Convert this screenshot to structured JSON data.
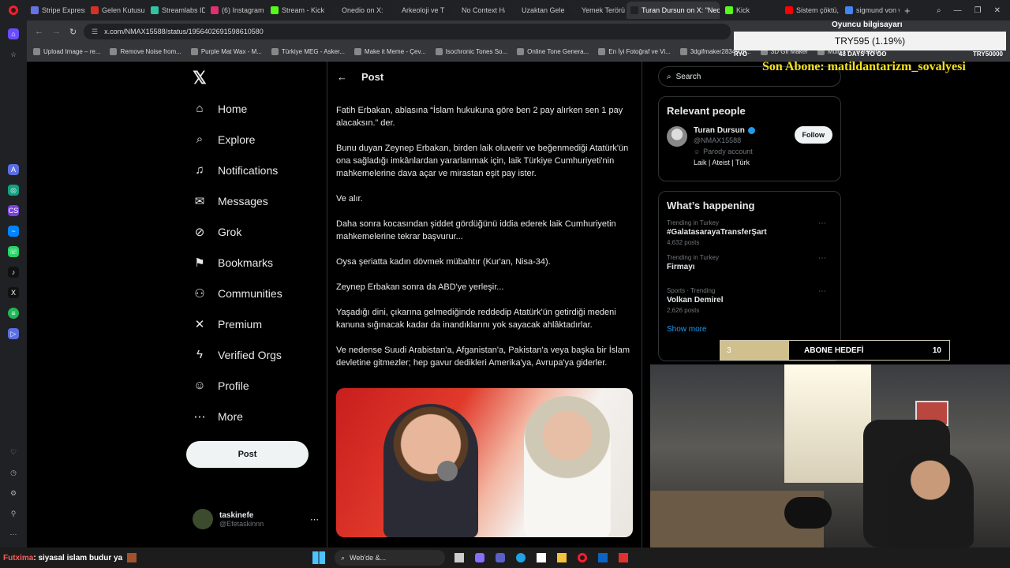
{
  "browser": {
    "tabs": [
      {
        "label": "Stripe Express",
        "color": "#6772e5"
      },
      {
        "label": "Gelen Kutusu (5",
        "color": "#d93025"
      },
      {
        "label": "Streamlabs ID -",
        "color": "#31c3a2"
      },
      {
        "label": "(6) Instagram",
        "color": "#e1306c"
      },
      {
        "label": "Stream - Kick D",
        "color": "#53fc18"
      },
      {
        "label": "Onedio on X: \"",
        "color": "#222"
      },
      {
        "label": "Arkeoloji ve TÜ",
        "color": "#222"
      },
      {
        "label": "No Context Ha",
        "color": "#222"
      },
      {
        "label": "Uzaktan Gelen",
        "color": "#222"
      },
      {
        "label": "Yemek Terörü ¢",
        "color": "#222"
      },
      {
        "label": "Turan Dursun on X: \"Nec",
        "color": "#222",
        "active": true
      },
      {
        "label": "Kick",
        "color": "#53fc18"
      },
      {
        "label": "Sistem çöktü, b",
        "color": "#ff0000"
      },
      {
        "label": "sigmund von w",
        "color": "#4285f4"
      }
    ],
    "url": "x.com/NMAX15588/status/1956402691598610580",
    "bookmarks": [
      "Upload Image – re...",
      "Remove Noise from...",
      "Purple Mat Wax - M...",
      "Türkiye MEG - Asker...",
      "Make it Meme - Çev...",
      "Isochronic Tones So...",
      "Online Tone Genera...",
      "En İyi Fotoğraf ve Vi...",
      "3dgifmaker28349.gi...",
      "3D Gif Maker",
      "Multi TV - 9 haberk..."
    ]
  },
  "nav": {
    "items": [
      {
        "label": "Home",
        "icon": "⌂",
        "name": "home"
      },
      {
        "label": "Explore",
        "icon": "⌕",
        "name": "explore"
      },
      {
        "label": "Notifications",
        "icon": "♫",
        "name": "notifications"
      },
      {
        "label": "Messages",
        "icon": "✉",
        "name": "messages"
      },
      {
        "label": "Grok",
        "icon": "⊘",
        "name": "grok"
      },
      {
        "label": "Bookmarks",
        "icon": "⚑",
        "name": "bookmarks"
      },
      {
        "label": "Communities",
        "icon": "⚇",
        "name": "communities"
      },
      {
        "label": "Premium",
        "icon": "✕",
        "name": "premium"
      },
      {
        "label": "Verified Orgs",
        "icon": "ϟ",
        "name": "verified-orgs"
      },
      {
        "label": "Profile",
        "icon": "☺",
        "name": "profile"
      },
      {
        "label": "More",
        "icon": "⋯",
        "name": "more"
      }
    ],
    "post_button": "Post",
    "account": {
      "name": "taskinefe",
      "handle": "@Efetaskinnn"
    }
  },
  "timeline": {
    "header": "Post",
    "paragraphs": [
      "Fatih Erbakan, ablasına “İslam hukukuna göre ben 2 pay alırken sen 1 pay alacaksın.” der.",
      "Bunu duyan Zeynep Erbakan, birden laik oluverir ve beğenmediği Atatürk'ün ona sağladığı imkânlardan yararlanmak için, laik Türkiye Cumhuriyeti'nin mahkemelerine dava açar ve mirastan eşit pay ister.",
      "Ve alır.",
      "Daha sonra kocasından şiddet gördüğünü iddia ederek laik Cumhuriyetin mahkemelerine tekrar başvurur...",
      "Oysa şeriatta kadın dövmek mübahtır (Kur'an, Nisa-34).",
      "Zeynep Erbakan sonra da ABD'ye yerleşir...",
      "Yaşadığı dini, çıkarına gelmediğinde reddedip Atatürk'ün getirdiği medeni kanuna sığınacak kadar da inandıklarını yok sayacak ahlâktadırlar.",
      "Ve nedense Suudi Arabistan'a, Afganistan'a, Pakistan'a veya başka bir İslam devletine gitmezler; hep gavur dedikleri Amerika'ya, Avrupa'ya giderler."
    ]
  },
  "right": {
    "search_placeholder": "Search",
    "relevant_title": "Relevant people",
    "person": {
      "name": "Turan Dursun",
      "handle": "@NMAX15588",
      "badge": "Parody account",
      "bio": "Laik | Ateist | Türk",
      "follow": "Follow"
    },
    "happening_title": "What’s happening",
    "trends": [
      {
        "cat": "Trending in Turkey",
        "title": "#GalatasarayaTransferŞart",
        "count": "4,632 posts"
      },
      {
        "cat": "Trending in Turkey",
        "title": "Firmayı",
        "count": ""
      },
      {
        "cat": "Sports · Trending",
        "title": "Volkan Demirel",
        "count": "2,626 posts"
      }
    ],
    "show_more": "Show more"
  },
  "overlay": {
    "goal_title": "Oyuncu bilgisayarı",
    "donation": "TRY595 (1.19%)",
    "goal_left": "RYO",
    "days_to_go": "48 DAYS TO GO",
    "goal_right": "TRY50000",
    "last_sub": "Son Abone: matildantarizm_sovalyesi",
    "abone_current": "3",
    "abone_label": "ABONE HEDEFİ",
    "abone_target": "10",
    "abone_progress": 0.3
  },
  "chat": {
    "user": "Futxima",
    "message": ": siyasal islam budur ya"
  },
  "taskbar": {
    "search_label": "Web'de &..."
  }
}
